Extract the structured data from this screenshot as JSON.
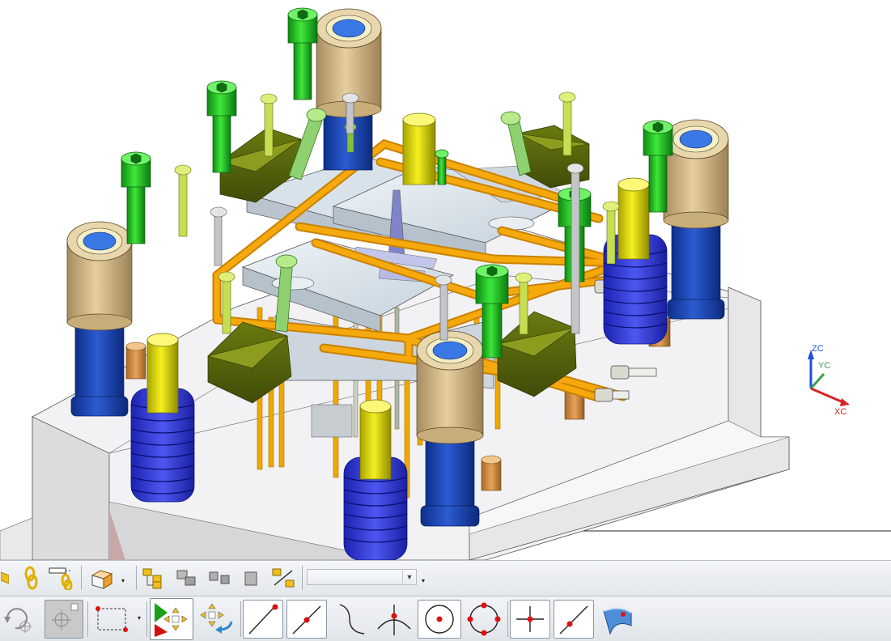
{
  "viewport": {
    "triad": {
      "zc_label": "ZC",
      "yc_label": "YC",
      "xc_label": "XC",
      "zc_color": "#1e4fd6",
      "yc_color": "#3aa04a",
      "xc_color": "#d82424"
    }
  },
  "toolbar_top": {
    "buttons": [
      {
        "name": "component-icon"
      },
      {
        "name": "assembly-constraints-icon"
      },
      {
        "name": "wave-geometry-linker-icon"
      },
      {
        "name": "view-solid-icon"
      },
      {
        "name": "assembly-tree-icon"
      },
      {
        "name": "replace-component-icon"
      },
      {
        "name": "mirror-assembly-icon"
      },
      {
        "name": "add-component-icon"
      },
      {
        "name": "explode-view-icon"
      }
    ],
    "filter_combo": {
      "value": ""
    }
  },
  "toolbar_snap": {
    "buttons": [
      {
        "name": "undo-arrow-icon"
      },
      {
        "name": "point-on-curve-icon"
      },
      {
        "name": "work-plane-icon"
      },
      {
        "name": "box-select-icon"
      },
      {
        "name": "enable-snap-point-icon"
      },
      {
        "name": "clear-snap-point-icon"
      },
      {
        "name": "end-point-icon"
      },
      {
        "name": "mid-point-icon"
      },
      {
        "name": "control-point-icon"
      },
      {
        "name": "intersection-point-icon"
      },
      {
        "name": "arc-center-icon"
      },
      {
        "name": "quadrant-point-icon"
      },
      {
        "name": "existing-point-icon"
      },
      {
        "name": "point-on-curve-snap-icon"
      },
      {
        "name": "point-on-face-icon"
      }
    ]
  }
}
